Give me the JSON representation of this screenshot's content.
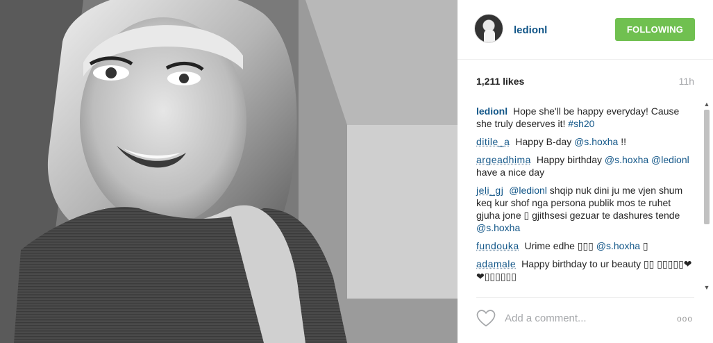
{
  "post": {
    "username": "ledionl",
    "follow_label": "FOLLOWING",
    "likes": "1,211 likes",
    "time": "11h",
    "add_comment_placeholder": "Add a comment...",
    "more_label": "ooo"
  },
  "comments": [
    {
      "user": "ledionl",
      "text": "Hope she'll be happy everyday! Cause she truly deserves it!",
      "tag": "#sh20"
    },
    {
      "user": "ditile_a",
      "text": "Happy B-day",
      "mention": "@s.hoxha",
      "suffix": "!!"
    },
    {
      "user": "argeadhima",
      "text": "Happy birthday",
      "mention": "@s.hoxha",
      "mention2": "@ledionl",
      "suffix": "have a nice day"
    },
    {
      "user": "jeli_gj",
      "mention": "@ledionl",
      "text": "shqip nuk dini ju me vjen shum keq kur shof nga persona publik mos te ruhet gjuha jone ▯ gjithsesi gezuar te dashures tende",
      "mention2": "@s.hoxha"
    },
    {
      "user": "fundouka",
      "text": "Urime edhe ▯▯▯",
      "mention": "@s.hoxha",
      "suffix": "▯"
    },
    {
      "user": "adamale",
      "text": "Happy birthday to ur beauty ▯▯ ▯▯▯▯▯❤❤▯▯▯▯▯▯"
    }
  ],
  "icons": {
    "heart": "heart-icon",
    "more": "more-options-icon",
    "scroll_up": "chevron-up-icon",
    "scroll_down": "chevron-down-icon"
  },
  "colors": {
    "link": "#125688",
    "follow": "#70c050",
    "muted": "#a5a7aa"
  }
}
